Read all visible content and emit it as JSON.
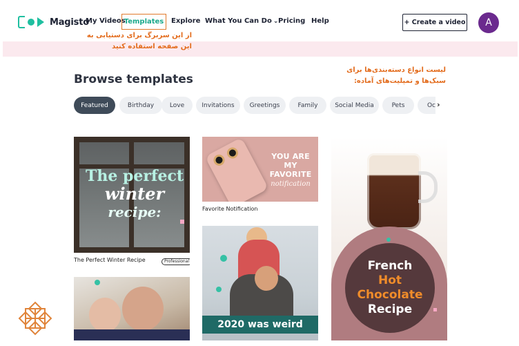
{
  "header": {
    "logo_text": "Magisto",
    "nav": {
      "my_videos": "My Videos",
      "templates": "Templates",
      "explore": "Explore",
      "what_you_can_do": "What You Can Do",
      "pricing": "Pricing",
      "help": "Help"
    },
    "create_button": "+ Create a video",
    "avatar_initial": "A"
  },
  "annotations": {
    "templates_note_line1": "از این سربرگ برای دستیابی به",
    "templates_note_line2": "این صفحه استفاده کنید",
    "categories_note_line1": "لیست انواع دسته‌بندی‌ها برای",
    "categories_note_line2": "سبک‌ها و تمپلیت‌های آماده:"
  },
  "page_title": "Browse templates",
  "categories": [
    "Featured",
    "Birthday",
    "Love",
    "Invitations",
    "Greetings",
    "Family",
    "Social Media",
    "Pets",
    "Oc"
  ],
  "active_category": "Featured",
  "templates": {
    "winter": {
      "caption": "The Perfect Winter Recipe",
      "badge": "Professional",
      "art_line1": "The perfect",
      "art_line2": "winter",
      "art_line3": "recipe:"
    },
    "favorite": {
      "caption": "Favorite Notification",
      "art_line1": "YOU ARE",
      "art_line2": "MY FAVORITE",
      "art_line3": "notification"
    },
    "chocolate": {
      "art_line1": "French",
      "art_line2": "Hot",
      "art_line3": "Chocolate",
      "art_line4": "Recipe"
    },
    "year": {
      "banner": "2020 was weird"
    }
  },
  "colors": {
    "brand_teal": "#1fbfa0",
    "annotation_orange": "#e36c1d",
    "avatar_purple": "#6b2a8e",
    "active_chip": "#3f4b59"
  }
}
